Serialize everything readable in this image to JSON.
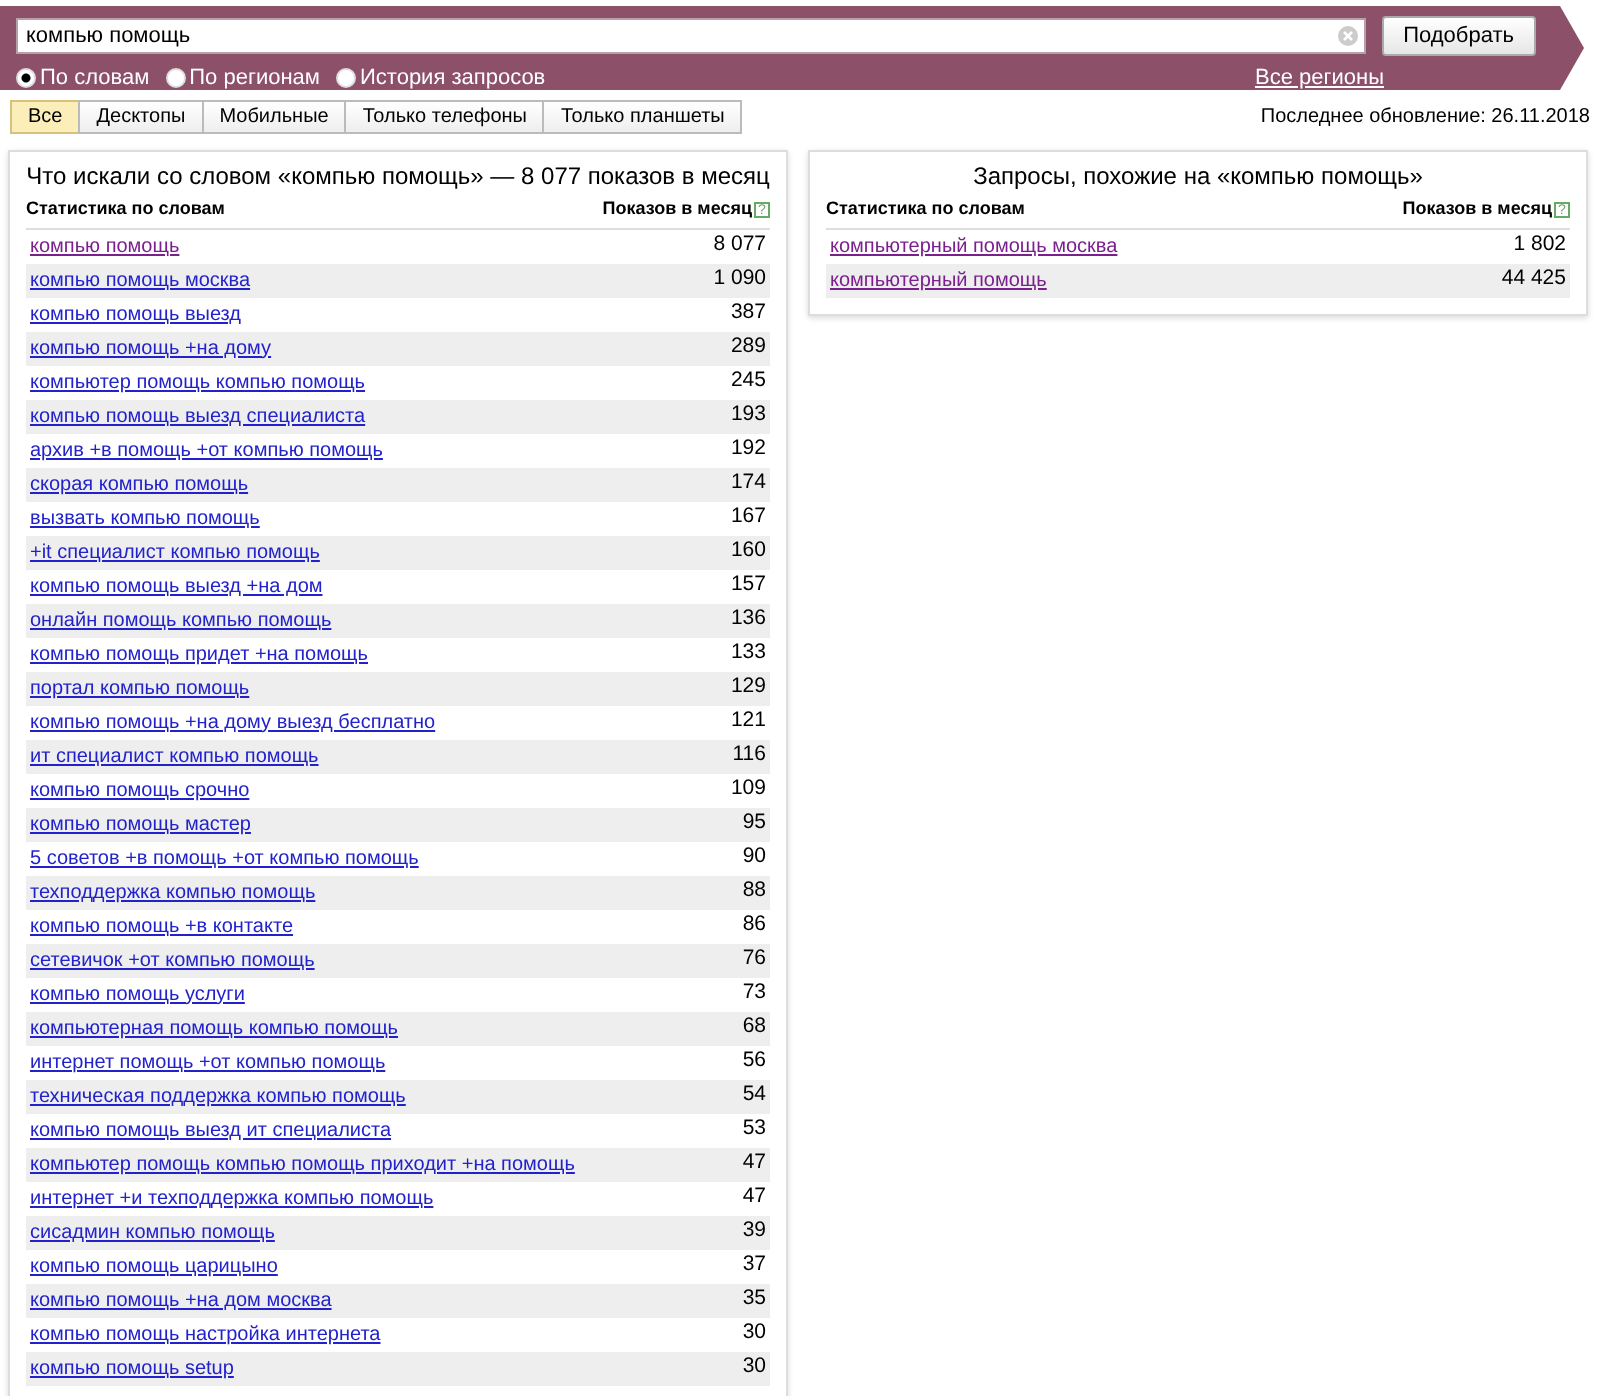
{
  "search": {
    "value": "компью помощь",
    "button": "Подобрать"
  },
  "modes": [
    {
      "label": "По словам",
      "selected": true
    },
    {
      "label": "По регионам",
      "selected": false
    },
    {
      "label": "История запросов",
      "selected": false
    }
  ],
  "regions_link": "Все регионы",
  "tabs": [
    {
      "label": "Все",
      "selected": true
    },
    {
      "label": "Десктопы",
      "selected": false
    },
    {
      "label": "Мобильные",
      "selected": false
    },
    {
      "label": "Только телефоны",
      "selected": false
    },
    {
      "label": "Только планшеты",
      "selected": false
    }
  ],
  "last_update": "Последнее обновление: 26.11.2018",
  "panels": [
    {
      "title": "Что искали со словом «компью помощь» — 8 077 показов в месяц",
      "col_words": "Статистика по словам",
      "col_count": "Показов в месяц",
      "help": "?",
      "rows": [
        {
          "query": "компью помощь",
          "count": "8 077",
          "visited": true
        },
        {
          "query": "компью помощь москва",
          "count": "1 090",
          "visited": false
        },
        {
          "query": "компью помощь выезд",
          "count": "387",
          "visited": false
        },
        {
          "query": "компью помощь +на дому",
          "count": "289",
          "visited": false
        },
        {
          "query": "компьютер помощь компью помощь",
          "count": "245",
          "visited": false
        },
        {
          "query": "компью помощь выезд специалиста",
          "count": "193",
          "visited": false
        },
        {
          "query": "архив +в помощь +от компью помощь",
          "count": "192",
          "visited": false
        },
        {
          "query": "скорая компью помощь",
          "count": "174",
          "visited": false
        },
        {
          "query": "вызвать компью помощь",
          "count": "167",
          "visited": false
        },
        {
          "query": "+it специалист компью помощь",
          "count": "160",
          "visited": false
        },
        {
          "query": "компью помощь выезд +на дом",
          "count": "157",
          "visited": false
        },
        {
          "query": "онлайн помощь компью помощь",
          "count": "136",
          "visited": false
        },
        {
          "query": "компью помощь придет +на помощь",
          "count": "133",
          "visited": false
        },
        {
          "query": "портал компью помощь",
          "count": "129",
          "visited": false
        },
        {
          "query": "компью помощь +на дому выезд бесплатно",
          "count": "121",
          "visited": false
        },
        {
          "query": "ит специалист компью помощь",
          "count": "116",
          "visited": false
        },
        {
          "query": "компью помощь срочно",
          "count": "109",
          "visited": false
        },
        {
          "query": "компью помощь мастер",
          "count": "95",
          "visited": false
        },
        {
          "query": "5 советов +в помощь +от компью помощь",
          "count": "90",
          "visited": false
        },
        {
          "query": "техподдержка компью помощь",
          "count": "88",
          "visited": false
        },
        {
          "query": "компью помощь +в контакте",
          "count": "86",
          "visited": false
        },
        {
          "query": "сетевичок +от компью помощь",
          "count": "76",
          "visited": false
        },
        {
          "query": "компью помощь услуги",
          "count": "73",
          "visited": false
        },
        {
          "query": "компьютерная помощь компью помощь",
          "count": "68",
          "visited": false
        },
        {
          "query": "интернет помощь +от компью помощь",
          "count": "56",
          "visited": false
        },
        {
          "query": "техническая поддержка компью помощь",
          "count": "54",
          "visited": false
        },
        {
          "query": "компью помощь выезд ит специалиста",
          "count": "53",
          "visited": false
        },
        {
          "query": "компьютер помощь компью помощь приходит +на помощь",
          "count": "47",
          "visited": false
        },
        {
          "query": "интернет +и техподдержка компью помощь",
          "count": "47",
          "visited": false
        },
        {
          "query": "сисадмин компью помощь",
          "count": "39",
          "visited": false
        },
        {
          "query": "компью помощь царицыно",
          "count": "37",
          "visited": false
        },
        {
          "query": "компью помощь +на дом москва",
          "count": "35",
          "visited": false
        },
        {
          "query": "компью помощь настройка интернета",
          "count": "30",
          "visited": false
        },
        {
          "query": "компью помощь setup",
          "count": "30",
          "visited": false
        }
      ]
    },
    {
      "title": "Запросы, похожие на «компью помощь»",
      "col_words": "Статистика по словам",
      "col_count": "Показов в месяц",
      "help": "?",
      "rows": [
        {
          "query": "компьютерный помощь москва",
          "count": "1 802",
          "visited": true
        },
        {
          "query": "компьютерный помощь",
          "count": "44 425",
          "visited": true
        }
      ]
    }
  ]
}
